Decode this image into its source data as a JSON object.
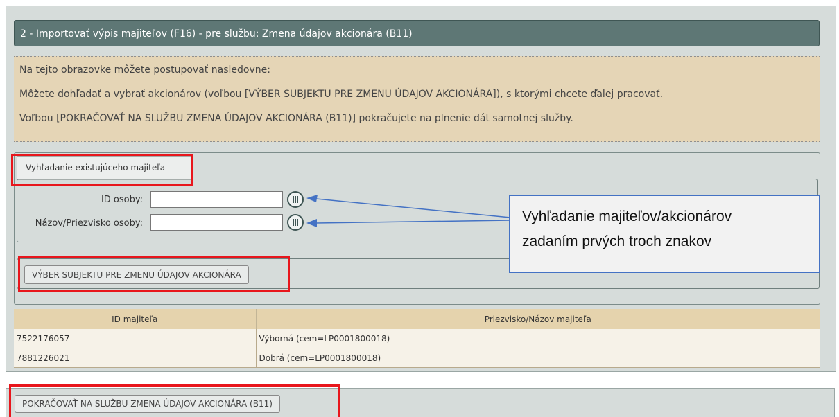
{
  "window": {
    "title": "2 - Importovať výpis majiteľov (F16) - pre službu: Zmena údajov akcionára (B11)"
  },
  "info": {
    "lines": [
      "Na tejto obrazovke môžete postupovať nasledovne:",
      "Môžete dohľadať a vybrať akcionárov (voľbou [VÝBER SUBJEKTU PRE ZMENU ÚDAJOV AKCIONÁRA]), s ktorými chcete ďalej pracovať.",
      "Voľbou [POKRAČOVAŤ NA SLUŽBU ZMENA ÚDAJOV AKCIONÁRA (B11)] pokračujete na plnenie dát samotnej služby."
    ]
  },
  "search": {
    "tab_label": "Vyhľadanie existujúceho majiteľa",
    "id_label": "ID osoby:",
    "id_value": "",
    "name_label": "Názov/Priezvisko osoby:",
    "name_value": "",
    "select_button": "VÝBER SUBJEKTU PRE ZMENU ÚDAJOV AKCIONÁRA",
    "lookup_icon": "lookup-list-icon"
  },
  "table": {
    "headers": [
      "ID majiteľa",
      "Priezvisko/Názov majiteľa"
    ],
    "rows": [
      [
        "7522176057",
        "Výborná (cem=LP0001800018)"
      ],
      [
        "7881226021",
        "Dobrá (cem=LP0001800018)"
      ]
    ]
  },
  "footer": {
    "continue_button": "POKRAČOVAŤ NA SLUŽBU ZMENA ÚDAJOV AKCIONÁRA (B11)"
  },
  "annotation": {
    "callout_lines": [
      "Vyhľadanie majiteľov/akcionárov",
      "zadaním prvých troch znakov"
    ],
    "highlight_color": "#e8161c",
    "callout_border_color": "#4472c4"
  }
}
